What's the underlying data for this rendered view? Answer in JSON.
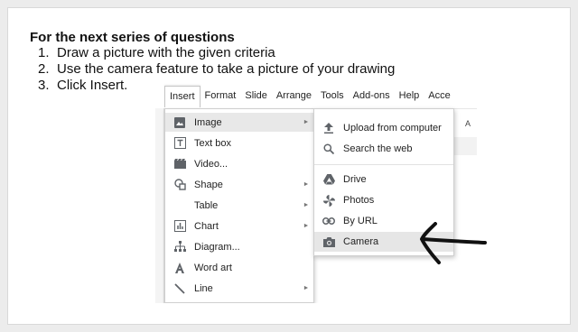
{
  "instructions": {
    "heading": "For the next series of questions",
    "steps": [
      {
        "num": "1.",
        "text": "Draw a picture with the given criteria"
      },
      {
        "num": "2.",
        "text": "Use the camera feature to take a picture of your drawing"
      },
      {
        "num": "3.",
        "text": "Click Insert."
      }
    ]
  },
  "menubar": {
    "items": [
      "Insert",
      "Format",
      "Slide",
      "Arrange",
      "Tools",
      "Add-ons",
      "Help",
      "Acce"
    ],
    "active_index": 0
  },
  "insert_menu": {
    "items": [
      {
        "label": "Image",
        "icon": "image-icon",
        "has_submenu": true,
        "highlighted": true
      },
      {
        "label": "Text box",
        "icon": "textbox-icon",
        "has_submenu": false
      },
      {
        "label": "Video...",
        "icon": "video-icon",
        "has_submenu": false
      },
      {
        "label": "Shape",
        "icon": "shape-icon",
        "has_submenu": true
      },
      {
        "label": "Table",
        "icon": "",
        "has_submenu": true
      },
      {
        "label": "Chart",
        "icon": "chart-icon",
        "has_submenu": true
      },
      {
        "label": "Diagram...",
        "icon": "diagram-icon",
        "has_submenu": false
      },
      {
        "label": "Word art",
        "icon": "wordart-icon",
        "has_submenu": false
      },
      {
        "label": "Line",
        "icon": "line-icon",
        "has_submenu": true
      }
    ]
  },
  "image_submenu": {
    "items": [
      {
        "label": "Upload from computer",
        "icon": "upload-icon"
      },
      {
        "label": "Search the web",
        "icon": "search-icon"
      },
      {
        "label": "Drive",
        "icon": "drive-icon"
      },
      {
        "label": "Photos",
        "icon": "photos-icon"
      },
      {
        "label": "By URL",
        "icon": "link-icon"
      },
      {
        "label": "Camera",
        "icon": "camera-icon",
        "highlighted": true
      }
    ]
  },
  "background": {
    "right_letter": "A"
  },
  "colors": {
    "menu_highlight": "#e8e8e8",
    "icon_gray": "#5f6368",
    "annotation_arrow": "#111111"
  }
}
